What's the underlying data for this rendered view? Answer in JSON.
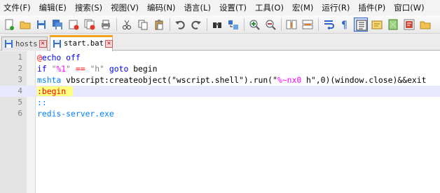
{
  "menu": [
    "文件(F)",
    "编辑(E)",
    "搜索(S)",
    "视图(V)",
    "编码(N)",
    "语言(L)",
    "设置(T)",
    "工具(O)",
    "宏(M)",
    "运行(R)",
    "插件(P)",
    "窗口(W)"
  ],
  "toolbar_icons": [
    "new-file-icon",
    "open-file-icon",
    "save-icon",
    "save-all-icon",
    "close-icon",
    "close-all-icon",
    "print-icon",
    "cut-icon",
    "copy-icon",
    "paste-icon",
    "undo-icon",
    "redo-icon",
    "find-icon",
    "replace-icon",
    "zoom-in-icon",
    "zoom-out-icon",
    "sync-vertical-icon",
    "sync-horizontal-icon",
    "word-wrap-icon",
    "show-all-chars-icon",
    "indent-guide-icon",
    "user-language-icon",
    "doc-map-icon",
    "function-list-icon",
    "folder-workspace-icon"
  ],
  "tabs": [
    {
      "label": "hosts",
      "active": false
    },
    {
      "label": "start.bat",
      "active": true
    }
  ],
  "editor": {
    "line_numbers": [
      "1",
      "2",
      "3",
      "4",
      "5",
      "6"
    ],
    "current_line": 4,
    "lines": [
      [
        {
          "t": "@",
          "c": "at"
        },
        {
          "t": "echo off",
          "c": "kw"
        }
      ],
      [
        {
          "t": "if ",
          "c": "kw"
        },
        {
          "t": "\"",
          "c": "str"
        },
        {
          "t": "%1",
          "c": "var"
        },
        {
          "t": "\"",
          "c": "str"
        },
        {
          "t": " == ",
          "c": "op"
        },
        {
          "t": "\"h\"",
          "c": "str"
        },
        {
          "t": " goto ",
          "c": "kw"
        },
        {
          "t": "begin",
          "c": "plain"
        }
      ],
      [
        {
          "t": "mshta ",
          "c": "cmd"
        },
        {
          "t": "vbscript:createobject(\"wscript.shell\").run(\"",
          "c": "plain"
        },
        {
          "t": "%~nx0",
          "c": "var"
        },
        {
          "t": " h\",0)(window.close)&&exit",
          "c": "plain"
        }
      ],
      [
        {
          "t": ":begin",
          "c": "lbl"
        }
      ],
      [
        {
          "t": "::",
          "c": "cmd"
        }
      ],
      [
        {
          "t": "redis-server.exe",
          "c": "cmd"
        }
      ]
    ]
  },
  "colors": {
    "keyword": "#0000ff",
    "string": "#808080",
    "variable": "#ff00ff",
    "operator": "#ff0000",
    "label_highlight": "#ffff80",
    "active_tab_accent": "#f4a21f"
  }
}
